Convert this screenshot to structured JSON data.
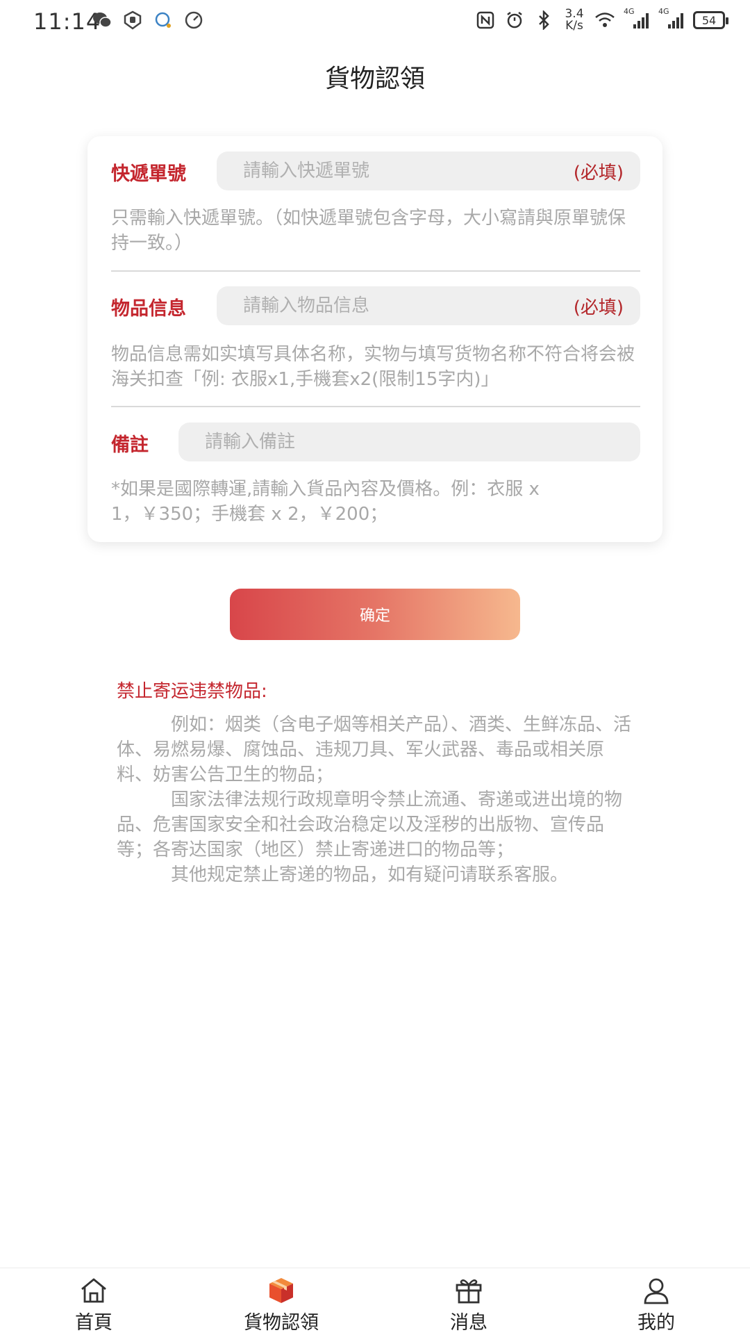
{
  "status_bar": {
    "time": "11:14",
    "net_speed_value": "3.4",
    "net_speed_unit": "K/s",
    "signal1_label": "4G",
    "signal2_label": "4G",
    "battery": "54"
  },
  "header": {
    "title": "貨物認領"
  },
  "form": {
    "tracking": {
      "label": "快遞單號",
      "placeholder": "請輸入快遞單號",
      "required": "(必填)",
      "hint": "只需輸入快遞單號。（如快遞單號包含字母，大小寫請與原單號保持一致。）"
    },
    "item": {
      "label": "物品信息",
      "placeholder": "請輸入物品信息",
      "required": "(必填)",
      "hint": "物品信息需如实填写具体名称，实物与填写货物名称不符合将会被海关扣查「例: 衣服x1,手機套x2(限制15字内)」"
    },
    "note": {
      "label": "備註",
      "placeholder": "請輸入備註",
      "hint": "*如果是國際轉運,請輸入貨品內容及價格。例：衣服 x 1，￥350；手機套 x 2，￥200；"
    }
  },
  "confirm_label": "确定",
  "prohibited": {
    "title": "禁止寄运违禁物品:",
    "paragraphs": [
      "例如：烟类（含电子烟等相关产品）、酒类、生鲜冻品、活体、易燃易爆、腐蚀品、违规刀具、军火武器、毒品或相关原料、妨害公告卫生的物品；",
      "国家法律法规行政规章明令禁止流通、寄递或进出境的物品、危害国家安全和社会政治稳定以及淫秽的出版物、宣传品等；各寄达国家（地区）禁止寄递进口的物品等；",
      "其他规定禁止寄递的物品，如有疑问请联系客服。"
    ]
  },
  "nav": {
    "items": [
      {
        "label": "首頁",
        "icon": "home-icon"
      },
      {
        "label": "貨物認領",
        "icon": "package-icon"
      },
      {
        "label": "消息",
        "icon": "gift-icon"
      },
      {
        "label": "我的",
        "icon": "user-icon"
      }
    ]
  },
  "colors": {
    "accent": "#c4262e",
    "hint_text": "#a8a8a8",
    "field_bg": "#efefef",
    "button_gradient_start": "#d8464a",
    "button_gradient_end": "#f6b88e"
  }
}
